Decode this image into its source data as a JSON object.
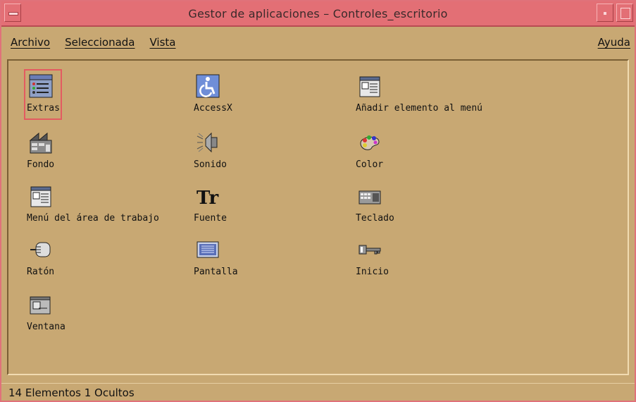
{
  "window": {
    "title": "Gestor de aplicaciones – Controles_escritorio"
  },
  "menubar": {
    "archivo": "Archivo",
    "seleccionada": "Seleccionada",
    "vista": "Vista",
    "ayuda": "Ayuda"
  },
  "items": [
    {
      "label": "Extras",
      "icon": "extras-icon",
      "selected": true
    },
    {
      "label": "AccessX",
      "icon": "accessibility-icon"
    },
    {
      "label": "Añadir elemento al menú",
      "icon": "add-menu-item-icon"
    },
    {
      "label": "Fondo",
      "icon": "backdrop-icon"
    },
    {
      "label": "Sonido",
      "icon": "speaker-icon"
    },
    {
      "label": "Color",
      "icon": "palette-icon"
    },
    {
      "label": "Menú del área de trabajo",
      "icon": "workspace-menu-icon"
    },
    {
      "label": "Fuente",
      "icon": "font-icon"
    },
    {
      "label": "Teclado",
      "icon": "keyboard-icon"
    },
    {
      "label": "Ratón",
      "icon": "mouse-icon"
    },
    {
      "label": "Pantalla",
      "icon": "screen-icon"
    },
    {
      "label": "Inicio",
      "icon": "startup-key-icon"
    },
    {
      "label": "Ventana",
      "icon": "window-icon"
    }
  ],
  "status": {
    "text": "14 Elementos 1 Ocultos"
  },
  "colors": {
    "background": "#c8a873",
    "titlebar": "#e36f75",
    "selection": "#e35b61"
  }
}
